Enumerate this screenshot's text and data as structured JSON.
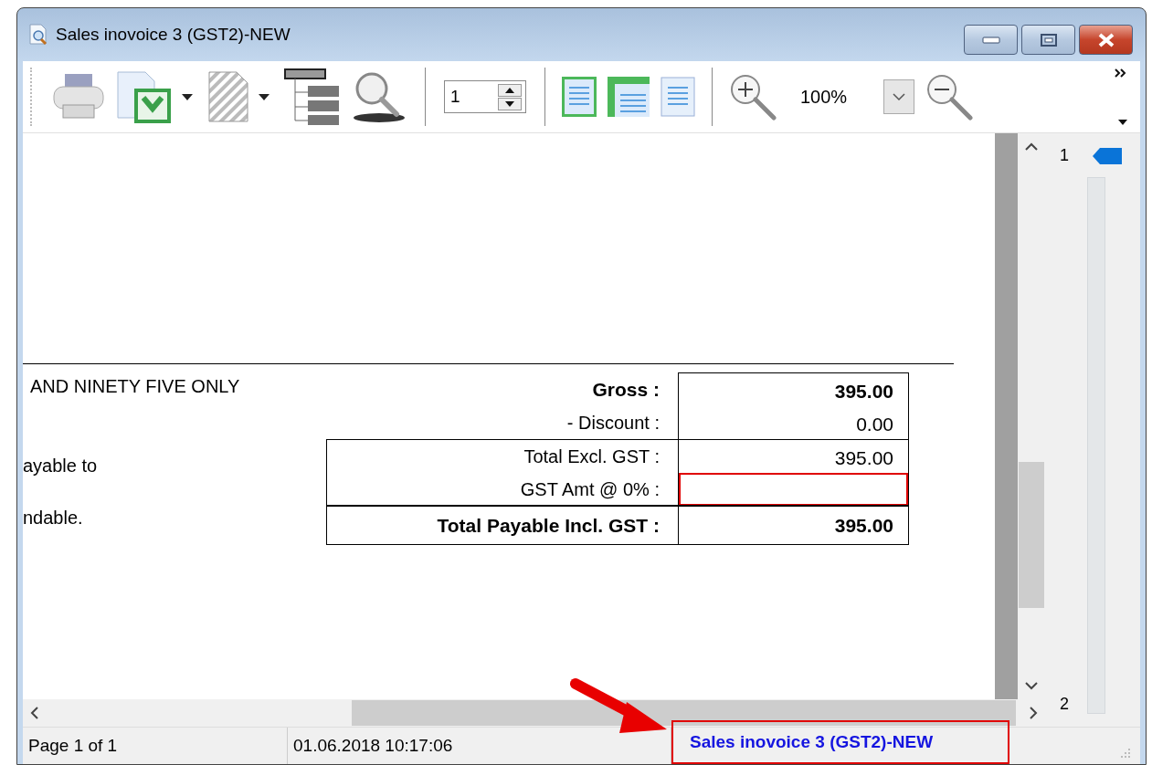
{
  "window": {
    "title": "Sales inovoice 3 (GST2)-NEW"
  },
  "toolbar": {
    "page_number": "1",
    "zoom": "100%"
  },
  "document": {
    "amount_words": "AND NINETY FIVE ONLY",
    "notes": [
      "ayable to",
      "ndable."
    ],
    "totals": [
      {
        "label_boxed": false,
        "rows": [
          {
            "label": "Gross :",
            "value": "395.00",
            "bold": true,
            "highlighted": false
          },
          {
            "label": "- Discount :",
            "value": "0.00",
            "bold": false,
            "highlighted": false
          }
        ]
      },
      {
        "label_boxed": true,
        "rows": [
          {
            "label": "Total Excl. GST :",
            "value": "395.00",
            "bold": false,
            "highlighted": false
          },
          {
            "label": "GST Amt @ 0% :",
            "bold": false,
            "highlighted": true
          }
        ]
      },
      {
        "label_boxed": true,
        "rows": [
          {
            "label": "Total Payable Incl. GST :",
            "value": "395.00",
            "bold": true,
            "highlighted": false
          }
        ]
      }
    ]
  },
  "page_navigator": {
    "first": "1",
    "last": "2"
  },
  "status_bar": {
    "page": "Page 1 of 1",
    "datetime": "01.06.2018 10:17:06",
    "report_name": "Sales inovoice 3 (GST2)-NEW",
    "highlighted": true
  }
}
